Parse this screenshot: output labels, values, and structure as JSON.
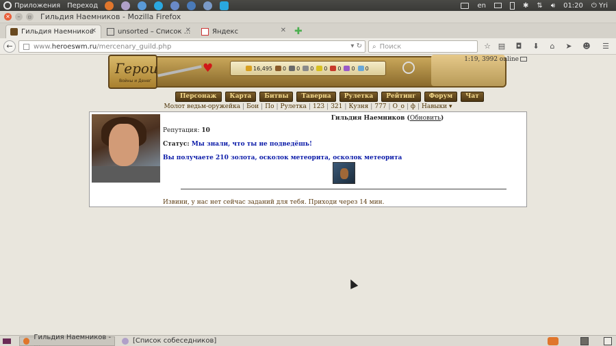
{
  "top_panel": {
    "menu_apps": "Приложения",
    "menu_go": "Переход",
    "lang": "en",
    "time": "01:20",
    "user": "Yri"
  },
  "window": {
    "title": "Гильдия Наемников - Mozilla Firefox"
  },
  "tabs": [
    {
      "label": "Гильдия Наемников",
      "active": true
    },
    {
      "label": "unsorted – Список ...",
      "active": false
    },
    {
      "label": "Яндекс",
      "active": false
    }
  ],
  "nav": {
    "url_prefix": "www.",
    "url_host": "heroeswm.ru",
    "url_path": "/mercenary_guild.php",
    "search_placeholder": "Поиск"
  },
  "game": {
    "logo_title": "Герои",
    "logo_subtitle": "Войны и Денег",
    "online": "1:19, 3992 online",
    "resources": [
      {
        "icon": "gold-icon",
        "value": "16,495",
        "color": "#d8a020"
      },
      {
        "icon": "wood-icon",
        "value": "0",
        "color": "#8a5a2a"
      },
      {
        "icon": "ore-icon",
        "value": "0",
        "color": "#6a6a6a"
      },
      {
        "icon": "mercury-icon",
        "value": "0",
        "color": "#8a8a8a"
      },
      {
        "icon": "sulfur-icon",
        "value": "0",
        "color": "#d8c020"
      },
      {
        "icon": "crystal-icon",
        "value": "0",
        "color": "#c83a2a"
      },
      {
        "icon": "gems-icon",
        "value": "0",
        "color": "#9a5ac8"
      },
      {
        "icon": "diamond-icon",
        "value": "0",
        "color": "#6aa8d8"
      }
    ],
    "menu": [
      "Персонаж",
      "Карта",
      "Битвы",
      "Таверна",
      "Рулетка",
      "Рейтинг",
      "Форум",
      "Чат"
    ],
    "sublinks": [
      "Молот ведьм-оружейка",
      "Бои",
      "По",
      "Рулетка",
      "123",
      "321",
      "Кузня",
      "777",
      "O_o",
      "ф",
      "Навыки ▾"
    ]
  },
  "guild": {
    "title": "Гильдия Наемников",
    "refresh_label": "Обновить",
    "reputation_label": "Репутация:",
    "reputation_value": "10",
    "status_label": "Статус:",
    "status_value": "Мы знали, что ты не подведёшь!",
    "reward_text": "Вы получаете 210 золота, осколок метеорита, осколок метеорита",
    "no_tasks_text": "Извини, у нас нет сейчас заданий для тебя. Приходи через 14 мин."
  },
  "taskbar": {
    "items": [
      {
        "label": "Гильдия Наемников - ...",
        "active": true
      },
      {
        "label": "[Список собеседников]",
        "active": false
      }
    ]
  }
}
